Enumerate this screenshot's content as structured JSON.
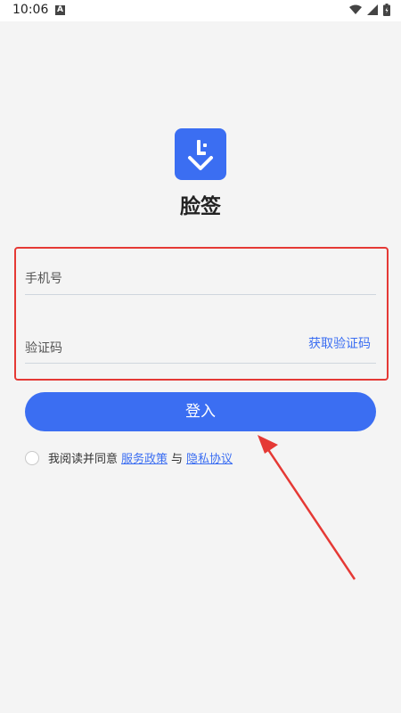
{
  "status_bar": {
    "time": "10:06",
    "notification_icon": "a-notification-icon",
    "icons": [
      "wifi-icon",
      "signal-icon",
      "battery-icon"
    ]
  },
  "app": {
    "name": "脸签",
    "brand_color": "#3b6ef2"
  },
  "form": {
    "phone_placeholder": "手机号",
    "phone_value": "",
    "code_placeholder": "验证码",
    "code_value": "",
    "get_code_label": "获取验证码"
  },
  "login_button": "登入",
  "agreement": {
    "prefix": "我阅读并同意",
    "service_policy": "服务政策",
    "conjunction": "与",
    "privacy_agreement": "隐私协议",
    "checked": false
  },
  "annotation": {
    "highlight_color": "#e53935"
  }
}
